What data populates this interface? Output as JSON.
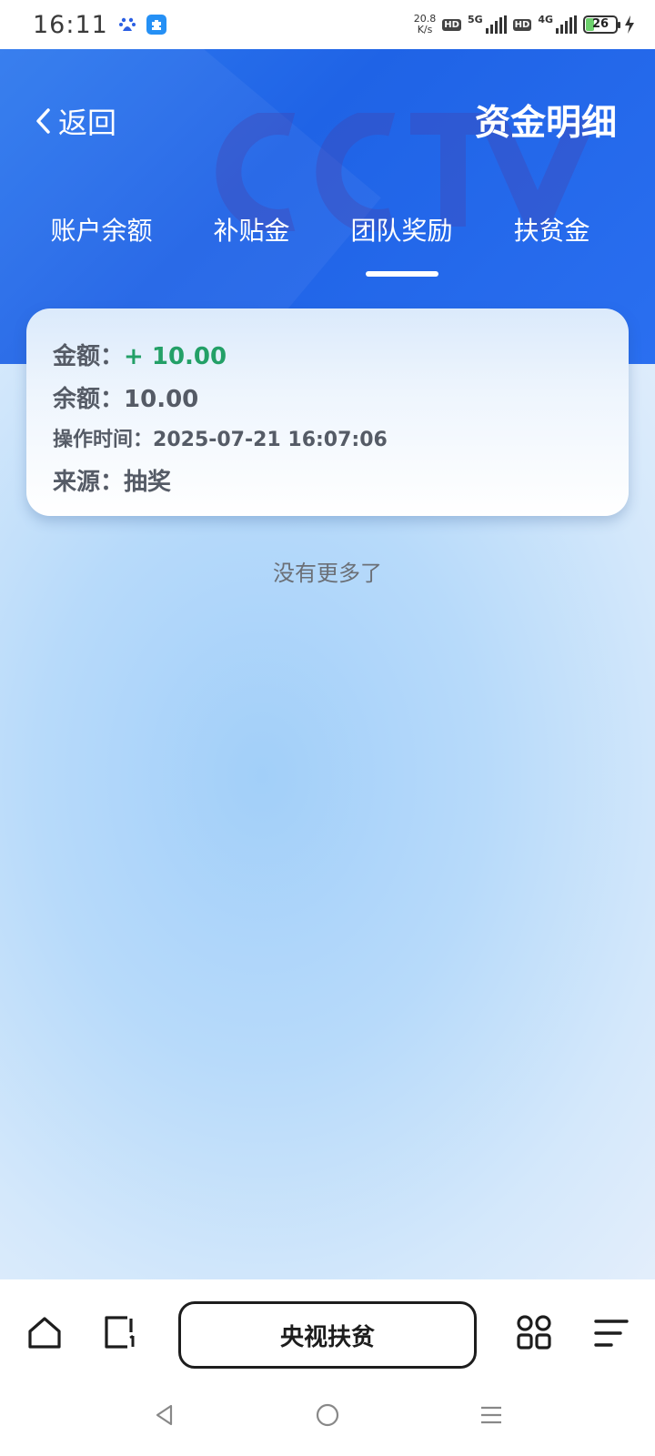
{
  "status_bar": {
    "time": "16:11",
    "net_speed_value": "20.8",
    "net_speed_unit": "K/s",
    "sim1_hd": "HD",
    "sim1_type": "5G",
    "sim2_hd": "HD",
    "sim2_type": "4G",
    "battery": "26",
    "battery_level": 0.26
  },
  "header": {
    "back_label": "返回",
    "title": "资金明细",
    "watermark": "CCTV",
    "tabs": [
      {
        "label": "账户余额",
        "active": false
      },
      {
        "label": "补贴金",
        "active": false
      },
      {
        "label": "团队奖励",
        "active": true
      },
      {
        "label": "扶贫金",
        "active": false
      }
    ]
  },
  "record": {
    "amount_label": "金额：",
    "amount_value": "+ 10.00",
    "balance_label": "余额：",
    "balance_value": "10.00",
    "time_label": "操作时间：",
    "time_value": "2025-07-21 16:07:06",
    "source_label": "来源：",
    "source_value": "抽奖"
  },
  "list_footer": "没有更多了",
  "toolbar": {
    "center_label": "央视扶贫"
  },
  "colors": {
    "header_blue": "#1f63e6",
    "amount_green": "#23a067"
  }
}
